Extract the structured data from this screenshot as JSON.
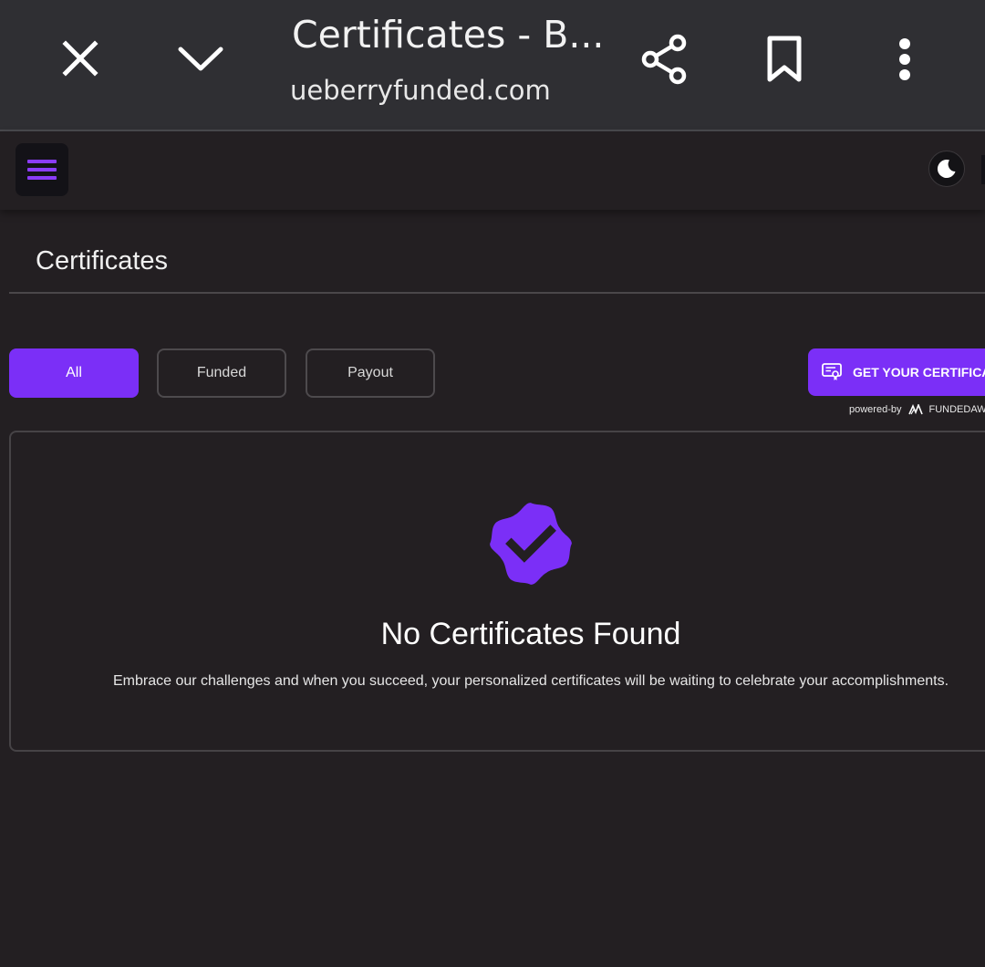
{
  "browser": {
    "title": "Certificates - B...",
    "url": "ueberryfunded.com",
    "icons": {
      "close": "close-icon",
      "collapse": "chevron-down-icon",
      "share": "share-icon",
      "bookmark": "bookmark-icon",
      "more": "more-vertical-icon"
    }
  },
  "app": {
    "menu_icon": "hamburger-menu-icon",
    "theme_icon": "moon-icon"
  },
  "page": {
    "title": "Certificates"
  },
  "filters": {
    "tabs": [
      {
        "label": "All",
        "active": true
      },
      {
        "label": "Funded",
        "active": false
      },
      {
        "label": "Payout",
        "active": false
      }
    ]
  },
  "cta": {
    "label": "GET YOUR CERTIFICAT",
    "powered_by": "powered-by",
    "powered_brand": "FUNDEDAW"
  },
  "empty_state": {
    "title": "No Certificates Found",
    "description": "Embrace our challenges and when you succeed, your personalized certificates will be waiting to celebrate your accomplishments."
  },
  "colors": {
    "accent": "#7b2ff7",
    "background": "#231f22",
    "browser_bar": "#2f2f33"
  }
}
